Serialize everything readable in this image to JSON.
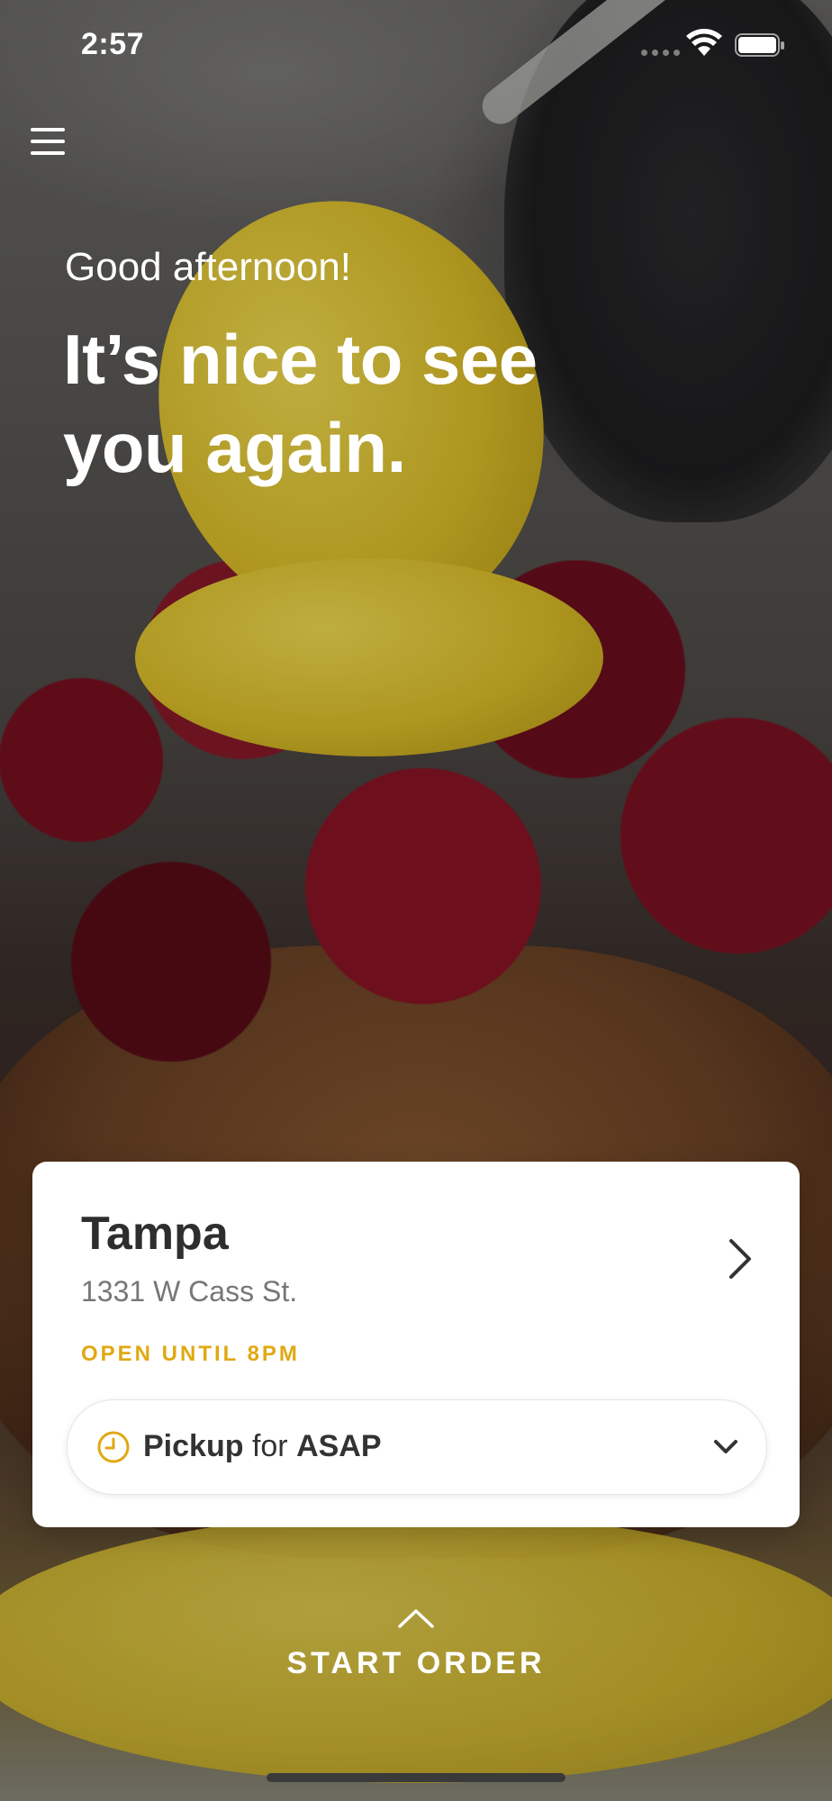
{
  "status_bar": {
    "time": "2:57"
  },
  "menu": {
    "icon": "hamburger-menu-icon"
  },
  "greeting": "Good afternoon!",
  "headline": "It’s nice to see you again.",
  "location_card": {
    "name": "Tampa",
    "address": "1331 W Cass St.",
    "hours": "OPEN UNTIL 8PM",
    "accent_color": "#E0A812",
    "pickup": {
      "mode": "Pickup",
      "connector": "for",
      "time": "ASAP"
    }
  },
  "start_order": {
    "label": "START ORDER"
  }
}
